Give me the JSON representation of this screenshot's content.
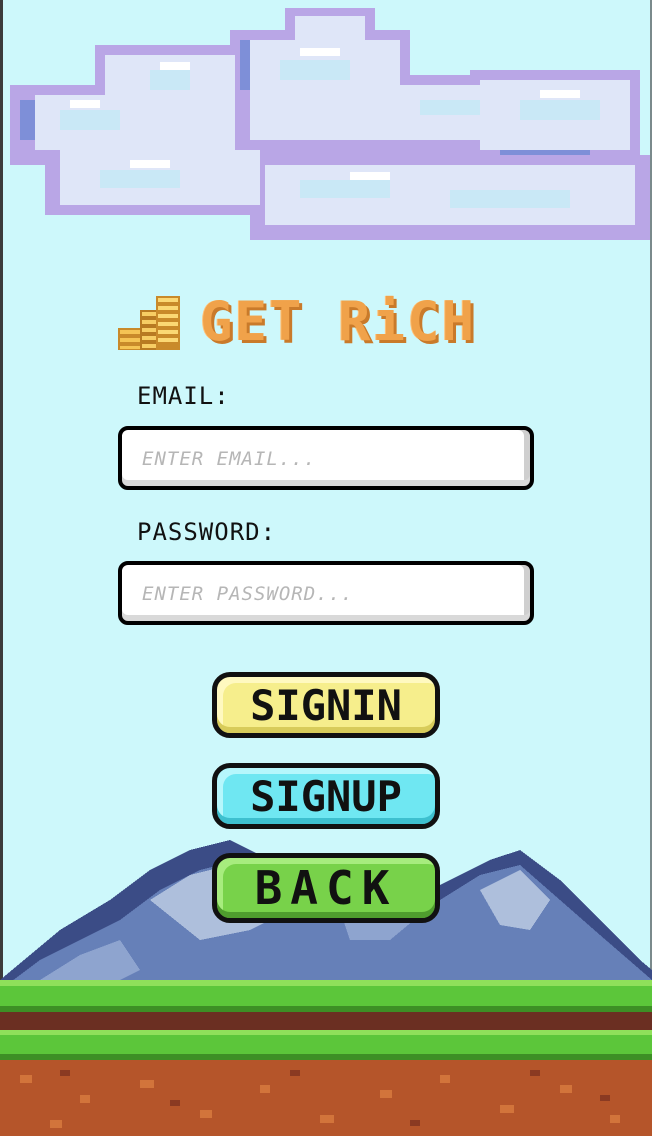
{
  "app": {
    "title": "GET RiCH"
  },
  "form": {
    "email_label": "EMAIL:",
    "email_placeholder": "ENTER EMAIL...",
    "email_value": "",
    "password_label": "PASSWORD:",
    "password_placeholder": "ENTER PASSWORD...",
    "password_value": ""
  },
  "buttons": {
    "signin": "SIGNIN",
    "signup": "SIGNUP",
    "back": "BACK"
  },
  "colors": {
    "sky": "#cdf8fb",
    "title": "#f0a24a",
    "signin": "#f6ee8c",
    "signup": "#6fe7f2",
    "back": "#78d24a",
    "grass": "#5cc63a",
    "dirt": "#b5552a",
    "mountain": "#5d78a8"
  },
  "icons": {
    "logo": "coin-stack-icon"
  }
}
